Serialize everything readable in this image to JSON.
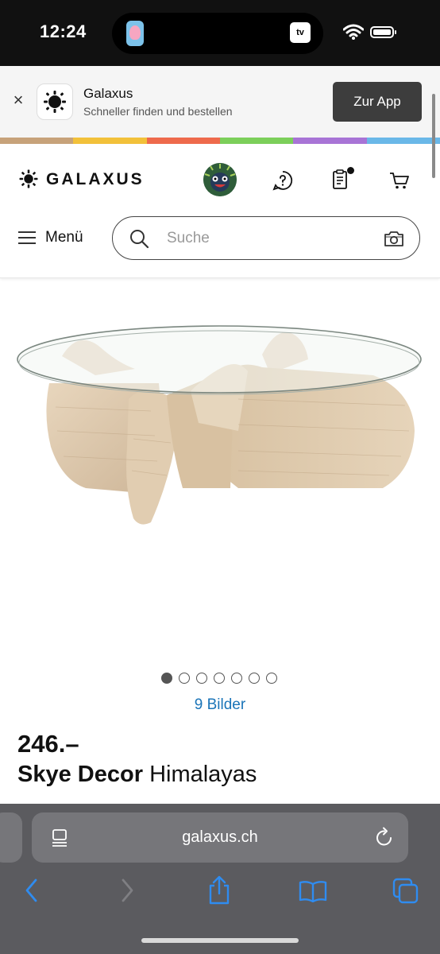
{
  "status_bar": {
    "time": "12:24",
    "island_tv_label": "tv"
  },
  "app_banner": {
    "close_icon": "close-icon",
    "title": "Galaxus",
    "subtitle": "Schneller finden und bestellen",
    "cta_label": "Zur App",
    "stripe_colors": [
      "#c7a27a",
      "#f2c13a",
      "#ee6a4c",
      "#7ccf5a",
      "#a874d6",
      "#6ab8e8"
    ]
  },
  "header": {
    "brand_name": "GALAXUS",
    "menu_label": "Menü",
    "search_placeholder": "Suche",
    "icons": [
      "help-icon",
      "orders-icon",
      "cart-icon",
      "camera-icon",
      "search-icon"
    ]
  },
  "product": {
    "image_alt": "Glass round coffee table on travertine base",
    "carousel_total_dots": 7,
    "carousel_active_index": 0,
    "image_count_label": "9 Bilder",
    "price": "246.–",
    "brand": "Skye Decor",
    "name": "Himalayas"
  },
  "safari": {
    "url": "galaxus.ch"
  },
  "colors": {
    "link": "#1a74b8",
    "banner_cta": "#3d3d3d",
    "safari_bar": "#5b5b5f",
    "safari_accent": "#2f8cf0"
  }
}
